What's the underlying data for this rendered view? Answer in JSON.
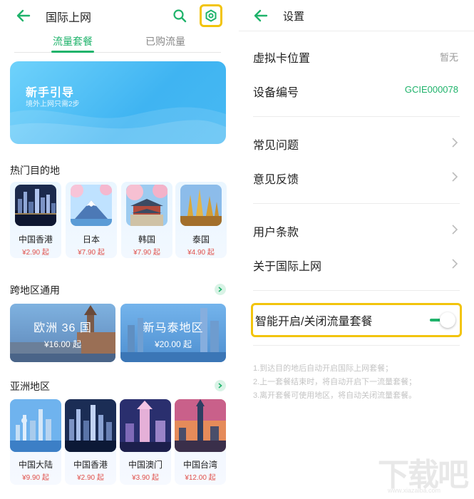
{
  "left": {
    "title": "国际上网",
    "tabs": [
      "流量套餐",
      "已购流量"
    ],
    "banner": {
      "title": "新手引导",
      "subtitle": "境外上网只需2步"
    },
    "hot": {
      "title": "热门目的地",
      "items": [
        {
          "name": "中国香港",
          "price": "¥2.90 起"
        },
        {
          "name": "日本",
          "price": "¥7.90 起"
        },
        {
          "name": "韩国",
          "price": "¥7.90 起"
        },
        {
          "name": "泰国",
          "price": "¥4.90 起"
        }
      ]
    },
    "cross": {
      "title": "跨地区通用",
      "items": [
        {
          "name": "欧洲 36 国",
          "price": "¥16.00 起"
        },
        {
          "name": "新马泰地区",
          "price": "¥20.00 起"
        }
      ]
    },
    "asia": {
      "title": "亚洲地区",
      "items": [
        {
          "name": "中国大陆",
          "price": "¥9.90 起"
        },
        {
          "name": "中国香港",
          "price": "¥2.90 起"
        },
        {
          "name": "中国澳门",
          "price": "¥3.90 起"
        },
        {
          "name": "中国台湾",
          "price": "¥12.00 起"
        }
      ]
    }
  },
  "right": {
    "title": "设置",
    "rows": {
      "vcard": {
        "label": "虚拟卡位置",
        "value": "暂无"
      },
      "device": {
        "label": "设备编号",
        "value": "GCIE000078"
      },
      "faq": {
        "label": "常见问题"
      },
      "feedback": {
        "label": "意见反馈"
      },
      "terms": {
        "label": "用户条款"
      },
      "about": {
        "label": "关于国际上网"
      }
    },
    "smart": {
      "label": "智能开启/关闭流量套餐",
      "enabled": true
    },
    "notes": [
      "1.到达目的地后自动开启国际上网套餐；",
      "2.上一套餐结束时，将自动开启下一流量套餐；",
      "3.离开套餐可使用地区，将自动关闭流量套餐。"
    ]
  },
  "watermark": {
    "text": "下载吧",
    "url": "www.xiazaiba.com"
  },
  "colors": {
    "accent": "#1fb36b",
    "highlight": "#f2c40c",
    "price": "#e0504a"
  }
}
